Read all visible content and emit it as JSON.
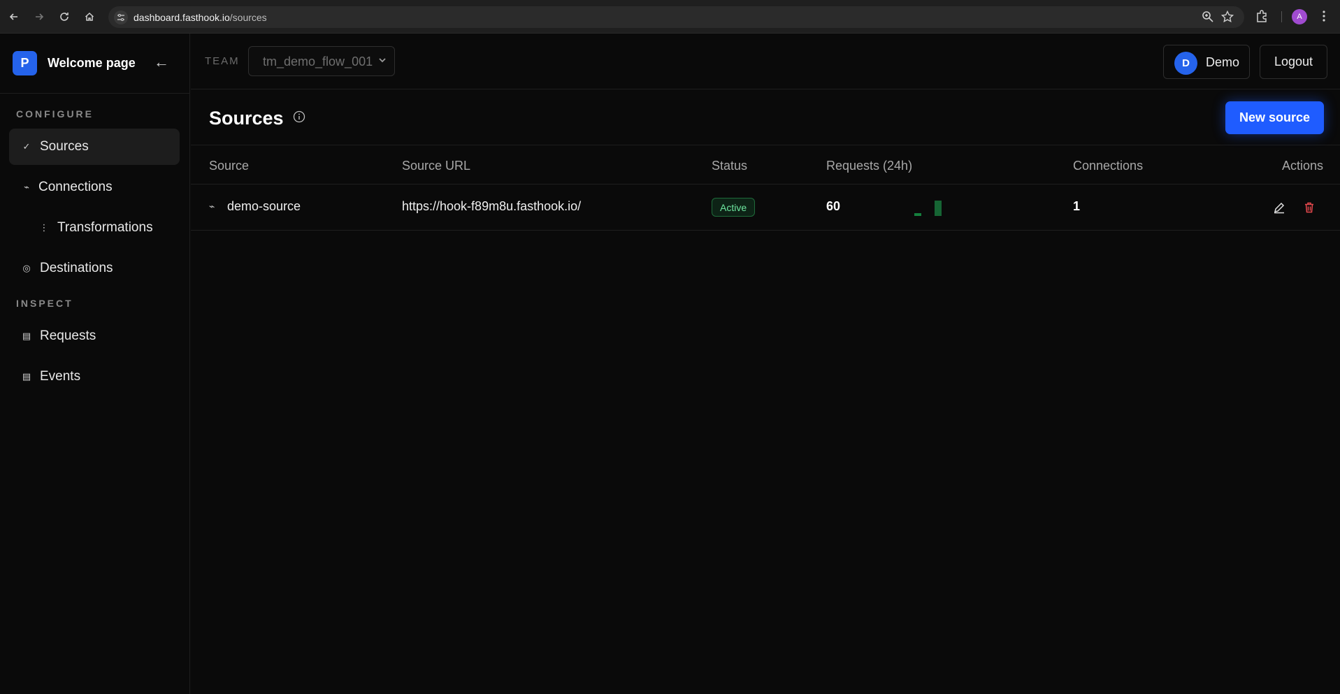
{
  "browser": {
    "url_domain": "dashboard.fasthook.io",
    "url_path": "/sources",
    "profile_initial": "A"
  },
  "sidebar": {
    "logo_letter": "P",
    "title": "Welcome page",
    "back_glyph": "←",
    "configure_label": "CONFIGURE",
    "inspect_label": "INSPECT",
    "items": [
      {
        "label": "Sources",
        "icon": "check-icon",
        "glyph": "✓"
      },
      {
        "label": "Connections",
        "icon": "flow-icon",
        "glyph": "⌁"
      },
      {
        "label": "Transformations",
        "icon": "dots-icon",
        "glyph": "⋮"
      },
      {
        "label": "Destinations",
        "icon": "target-icon",
        "glyph": "◎"
      },
      {
        "label": "Requests",
        "icon": "list-icon",
        "glyph": "▤"
      },
      {
        "label": "Events",
        "icon": "list-icon",
        "glyph": "▤"
      }
    ]
  },
  "header": {
    "team_label": "TEAM",
    "team_value": "tm_demo_flow_001",
    "user_initial": "D",
    "user_name": "Demo",
    "logout_label": "Logout"
  },
  "page": {
    "title": "Sources",
    "new_button_label": "New source"
  },
  "table": {
    "columns": [
      "Source",
      "Source URL",
      "Status",
      "Requests (24h)",
      "Connections",
      "Actions"
    ],
    "rows": [
      {
        "source_glyph": "⌁",
        "source": "demo-source",
        "url": "https://hook-f89m8u.fasthook.io/",
        "status": "Active",
        "requests": "60",
        "connections": "1"
      }
    ]
  },
  "colors": {
    "accent": "#1f5cff",
    "status_active": "#6ee7a0",
    "danger": "#e5484d"
  }
}
